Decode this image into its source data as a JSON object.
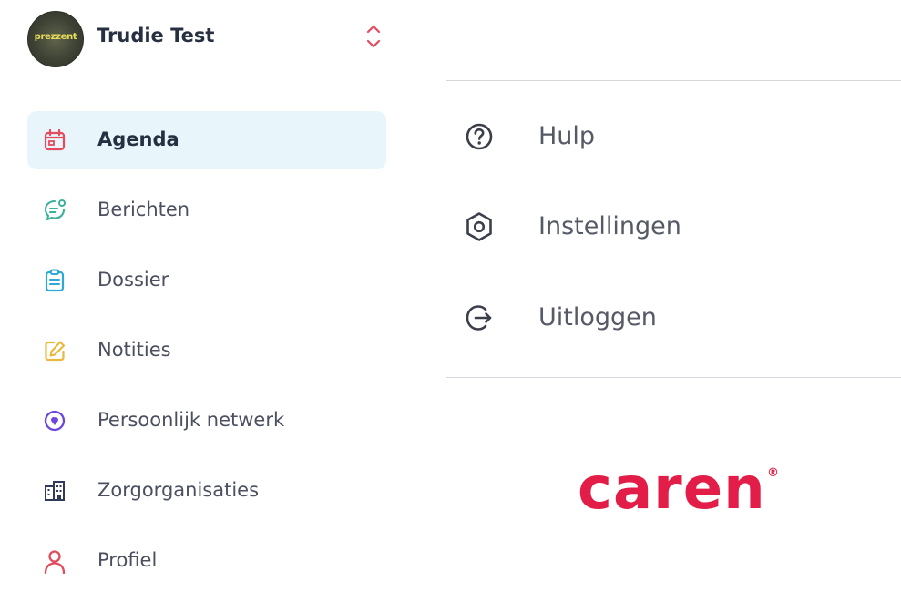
{
  "profile": {
    "avatar_text": "prezzent",
    "name": "Trudie Test"
  },
  "nav": {
    "items": [
      {
        "label": "Agenda",
        "icon": "calendar-icon",
        "color": "#e34b5e",
        "active": true
      },
      {
        "label": "Berichten",
        "icon": "chat-icon",
        "color": "#39b29c",
        "active": false
      },
      {
        "label": "Dossier",
        "icon": "clipboard-icon",
        "color": "#2ea9d6",
        "active": false
      },
      {
        "label": "Notities",
        "icon": "edit-icon",
        "color": "#e8b93d",
        "active": false
      },
      {
        "label": "Persoonlijk netwerk",
        "icon": "location-icon",
        "color": "#6d46e0",
        "active": false
      },
      {
        "label": "Zorgorganisaties",
        "icon": "building-icon",
        "color": "#2f3b57",
        "active": false
      },
      {
        "label": "Profiel",
        "icon": "user-icon",
        "color": "#e34b5e",
        "active": false
      }
    ]
  },
  "menu": {
    "items": [
      {
        "label": "Hulp",
        "icon": "help-circle-icon"
      },
      {
        "label": "Instellingen",
        "icon": "settings-icon"
      },
      {
        "label": "Uitloggen",
        "icon": "logout-icon"
      }
    ]
  },
  "brand": {
    "name": "caren",
    "mark": "®",
    "color": "#e11d48"
  }
}
